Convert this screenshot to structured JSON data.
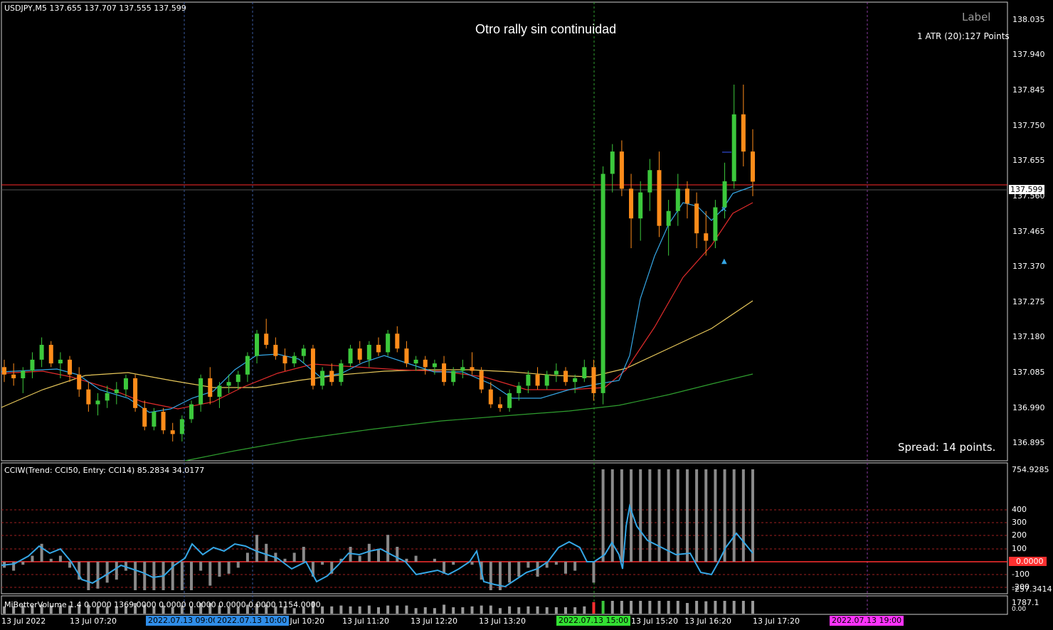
{
  "window": {
    "header": "USDJPY,M5  137.655 137.707 137.555 137.599",
    "chart_title": "Otro rally sin continuidad",
    "label_text": "Label",
    "atr_text": "1 ATR (20):127 Points",
    "spread_text": "Spread: 14 points."
  },
  "colors": {
    "bull": "#3cc83c",
    "bear": "#ff8c1a",
    "ma_fast": "#35a7e6",
    "ma_mid": "#e02b2b",
    "ma_slow": "#e8c85a",
    "ma_long": "#2f9e2f",
    "cci_line": "#35a7e6",
    "cci_hist": "#8a8a8a",
    "zero_line": "#ff3030",
    "current_price_tag": "#ffffff",
    "bid_line": "#ff2a2a"
  },
  "price_axis": {
    "ticks": [
      "138.035",
      "137.940",
      "137.845",
      "137.750",
      "137.655",
      "137.560",
      "137.465",
      "137.370",
      "137.275",
      "137.180",
      "137.085",
      "136.990",
      "136.895"
    ],
    "current_price": "137.599"
  },
  "cci_panel": {
    "header": "CCIW(Trend: CCI50, Entry: CCI14) 85.2834 34.0177",
    "top_value": "754.9285",
    "levels": [
      "400",
      "300",
      "200",
      "100",
      "0.0000",
      "-100",
      "-200",
      "-257.3414"
    ]
  },
  "volume_panel": {
    "header": "MiBetterVolume 1.4 0.0000 1369.0000 0.0000 0.0000 0.0000 0.0000 1154.0000",
    "top_value": "1787.1",
    "bottom_value": "0.00"
  },
  "time_axis": {
    "labels": [
      "13 Jul 2022",
      "13 Jul 07:20",
      "13 Jul 10:20",
      "13 Jul 11:20",
      "13 Jul 12:20",
      "13 Jul 13:20",
      "13 Jul 15:20",
      "13 Jul 16:20",
      "13 Jul 17:20"
    ],
    "badges": [
      {
        "text": "2022.07.13 09:00",
        "color": "#2f8de8"
      },
      {
        "text": "2022.07.13 10:00",
        "color": "#2f8de8"
      },
      {
        "text": "2022.07.13 15:00",
        "color": "#33e033"
      },
      {
        "text": "2022.07.13 19:00",
        "color": "#ff33ff"
      }
    ]
  },
  "chart_data": {
    "type": "candlestick",
    "symbol": "USDJPY,M5",
    "ylim": [
      136.85,
      138.08
    ],
    "ohlc": [
      [
        137.1,
        137.12,
        137.06,
        137.08
      ],
      [
        137.08,
        137.11,
        137.05,
        137.07
      ],
      [
        137.07,
        137.1,
        137.03,
        137.09
      ],
      [
        137.09,
        137.14,
        137.07,
        137.12
      ],
      [
        137.12,
        137.18,
        137.1,
        137.16
      ],
      [
        137.16,
        137.17,
        137.1,
        137.11
      ],
      [
        137.11,
        137.14,
        137.07,
        137.12
      ],
      [
        137.12,
        137.13,
        137.06,
        137.08
      ],
      [
        137.08,
        137.1,
        137.02,
        137.04
      ],
      [
        137.04,
        137.06,
        136.98,
        137.0
      ],
      [
        137.0,
        137.03,
        136.97,
        137.01
      ],
      [
        137.01,
        137.05,
        136.99,
        137.03
      ],
      [
        137.03,
        137.06,
        137.0,
        137.04
      ],
      [
        137.04,
        137.08,
        137.02,
        137.07
      ],
      [
        137.07,
        137.08,
        136.98,
        136.99
      ],
      [
        136.99,
        137.01,
        136.93,
        136.94
      ],
      [
        136.94,
        136.99,
        136.93,
        136.98
      ],
      [
        136.98,
        136.99,
        136.92,
        136.93
      ],
      [
        136.93,
        136.95,
        136.9,
        136.92
      ],
      [
        136.92,
        136.97,
        136.9,
        136.96
      ],
      [
        136.96,
        137.01,
        136.95,
        137.0
      ],
      [
        137.0,
        137.08,
        136.98,
        137.07
      ],
      [
        137.07,
        137.1,
        137.0,
        137.02
      ],
      [
        137.02,
        137.06,
        136.99,
        137.05
      ],
      [
        137.05,
        137.08,
        137.03,
        137.06
      ],
      [
        137.06,
        137.09,
        137.04,
        137.08
      ],
      [
        137.08,
        137.14,
        137.06,
        137.13
      ],
      [
        137.13,
        137.2,
        137.11,
        137.19
      ],
      [
        137.19,
        137.23,
        137.15,
        137.16
      ],
      [
        137.16,
        137.18,
        137.12,
        137.13
      ],
      [
        137.13,
        137.15,
        137.09,
        137.11
      ],
      [
        137.11,
        137.14,
        137.1,
        137.13
      ],
      [
        137.13,
        137.16,
        137.11,
        137.15
      ],
      [
        137.15,
        137.16,
        137.04,
        137.05
      ],
      [
        137.05,
        137.1,
        137.04,
        137.09
      ],
      [
        137.09,
        137.11,
        137.05,
        137.06
      ],
      [
        137.06,
        137.12,
        137.05,
        137.11
      ],
      [
        137.11,
        137.16,
        137.1,
        137.15
      ],
      [
        137.15,
        137.17,
        137.11,
        137.12
      ],
      [
        137.12,
        137.17,
        137.1,
        137.16
      ],
      [
        137.16,
        137.18,
        137.13,
        137.14
      ],
      [
        137.14,
        137.2,
        137.13,
        137.19
      ],
      [
        137.19,
        137.21,
        137.14,
        137.15
      ],
      [
        137.15,
        137.17,
        137.1,
        137.11
      ],
      [
        137.11,
        137.13,
        137.09,
        137.12
      ],
      [
        137.12,
        137.13,
        137.08,
        137.1
      ],
      [
        137.1,
        137.12,
        137.08,
        137.11
      ],
      [
        137.11,
        137.13,
        137.05,
        137.06
      ],
      [
        137.06,
        137.1,
        137.05,
        137.09
      ],
      [
        137.09,
        137.12,
        137.07,
        137.1
      ],
      [
        137.1,
        137.14,
        137.08,
        137.09
      ],
      [
        137.09,
        137.1,
        137.03,
        137.04
      ],
      [
        137.04,
        137.06,
        136.99,
        137.0
      ],
      [
        137.0,
        137.02,
        136.98,
        136.99
      ],
      [
        136.99,
        137.04,
        136.98,
        137.03
      ],
      [
        137.03,
        137.06,
        137.01,
        137.05
      ],
      [
        137.05,
        137.09,
        137.03,
        137.08
      ],
      [
        137.08,
        137.1,
        137.04,
        137.05
      ],
      [
        137.05,
        137.09,
        137.04,
        137.08
      ],
      [
        137.08,
        137.11,
        137.06,
        137.09
      ],
      [
        137.09,
        137.1,
        137.05,
        137.06
      ],
      [
        137.06,
        137.08,
        137.03,
        137.07
      ],
      [
        137.07,
        137.12,
        137.06,
        137.1
      ],
      [
        137.1,
        137.12,
        137.01,
        137.03
      ],
      [
        137.03,
        137.64,
        137.0,
        137.62
      ],
      [
        137.62,
        137.7,
        137.57,
        137.68
      ],
      [
        137.68,
        137.71,
        137.56,
        137.58
      ],
      [
        137.58,
        137.62,
        137.42,
        137.5
      ],
      [
        137.5,
        137.6,
        137.44,
        137.57
      ],
      [
        137.57,
        137.66,
        137.52,
        137.63
      ],
      [
        137.63,
        137.68,
        137.45,
        137.48
      ],
      [
        137.48,
        137.55,
        137.4,
        137.52
      ],
      [
        137.52,
        137.62,
        137.48,
        137.58
      ],
      [
        137.58,
        137.6,
        137.5,
        137.54
      ],
      [
        137.54,
        137.57,
        137.42,
        137.46
      ],
      [
        137.46,
        137.52,
        137.4,
        137.44
      ],
      [
        137.44,
        137.55,
        137.42,
        137.53
      ],
      [
        137.53,
        137.65,
        137.5,
        137.6
      ],
      [
        137.6,
        137.86,
        137.58,
        137.78
      ],
      [
        137.78,
        137.86,
        137.64,
        137.68
      ],
      [
        137.68,
        137.74,
        137.56,
        137.599
      ]
    ]
  }
}
